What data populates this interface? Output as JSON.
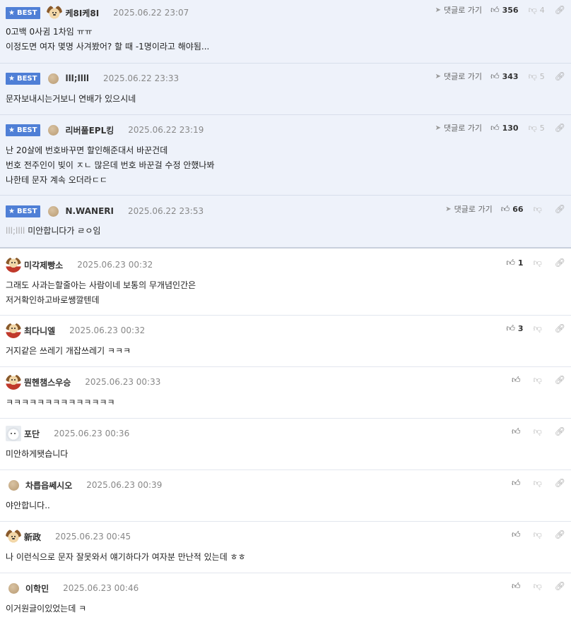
{
  "best_label": "BEST",
  "goto_label": "댓글로 가기",
  "comments": [
    {
      "best": true,
      "nick": "케8I케8I",
      "date": "2025.06.22 23:07",
      "up": "356",
      "down": "4",
      "body": "0고백 0사귐 1차임 ㅠㅠ\n이정도면 여자 몇명 사겨봤어? 할 때 -1명이라고 해야됨..."
    },
    {
      "best": true,
      "nick": "lll;llll",
      "date": "2025.06.22 23:33",
      "up": "343",
      "down": "5",
      "body": "문자보내시는거보니 연배가 있으시네"
    },
    {
      "best": true,
      "nick": "리버풀EPL킹",
      "date": "2025.06.22 23:19",
      "up": "130",
      "down": "5",
      "body": "난 20살에 번호바꾸면 할인해준대서 바꾼건데\n번호 전주인이 빚이 ㅈㄴ 많은데 번호 바꾼걸 수정 안했나봐\n나한테 문자 계속 오더라ㄷㄷ"
    },
    {
      "best": true,
      "nick": "N.WANERI",
      "date": "2025.06.22 23:53",
      "up": "66",
      "down": "",
      "body_prefix": "lll;llll",
      "body": "미안합니다가 ㄹㅇ임"
    },
    {
      "best": false,
      "nick": "미각제빵소",
      "date": "2025.06.23 00:32",
      "up": "1",
      "down": "",
      "body": "그래도 사과는할줄아는 사람이네 보통의 무개념인간은\n저거확인하고바로쌩깔텐데"
    },
    {
      "best": false,
      "nick": "최다니엘",
      "date": "2025.06.23 00:32",
      "up": "3",
      "down": "",
      "body": "거지같은 쓰레기 개잡쓰레기 ㅋㅋㅋ"
    },
    {
      "best": false,
      "nick": "뭔헨챔스우승",
      "date": "2025.06.23 00:33",
      "up": "",
      "down": "",
      "body": "ㅋㅋㅋㅋㅋㅋㅋㅋㅋㅋㅋㅋㅋㅋ"
    },
    {
      "best": false,
      "nick": "포단",
      "date": "2025.06.23 00:36",
      "up": "",
      "down": "",
      "body": "미안하게됏습니다"
    },
    {
      "best": false,
      "nick": "차릅읍쎄시오",
      "date": "2025.06.23 00:39",
      "up": "",
      "down": "",
      "body": "야안합니다.."
    },
    {
      "best": false,
      "nick": "新政",
      "date": "2025.06.23 00:45",
      "up": "",
      "down": "",
      "body": "나 이런식으로 문자 잘못와서 얘기하다가 여자분 만난적 있는데 ㅎㅎ"
    },
    {
      "best": false,
      "nick": "이학민",
      "date": "2025.06.23 00:46",
      "up": "",
      "down": "",
      "body": "이거원글이있었는데 ㅋ"
    }
  ],
  "icons": {
    "star": "star-icon",
    "arrow": "send-arrow-icon",
    "thumb_up": "thumb-up-icon",
    "thumb_down": "thumb-down-icon",
    "link": "link-icon"
  },
  "colors": {
    "best_badge": "#4f7fd6",
    "best_bg": "#eef2fa"
  }
}
